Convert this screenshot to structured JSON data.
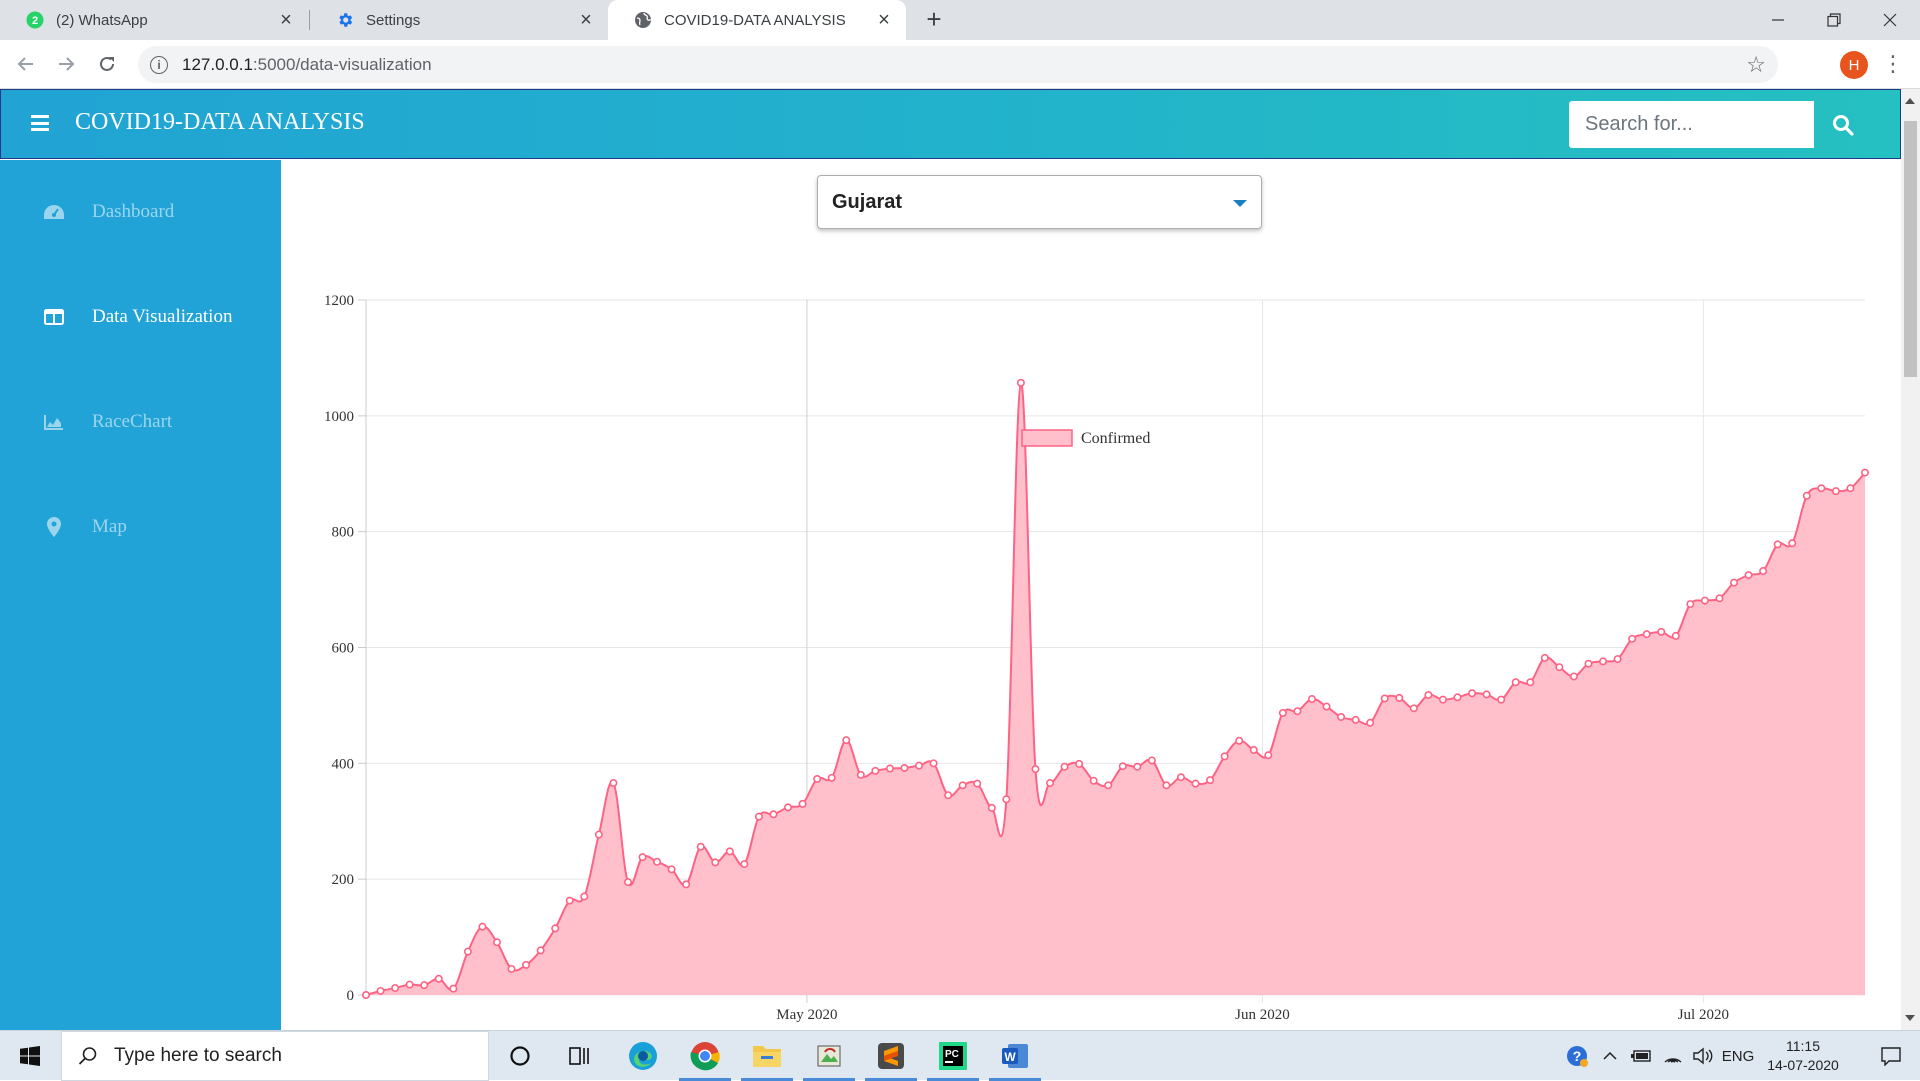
{
  "browser": {
    "tabs": [
      {
        "title": "(2) WhatsApp",
        "badge": "2",
        "icon": "whatsapp-icon",
        "active": false
      },
      {
        "title": "Settings",
        "icon": "gear-icon",
        "active": false
      },
      {
        "title": "COVID19-DATA ANALYSIS",
        "icon": "globe-icon",
        "active": true
      }
    ],
    "url_host": "127.0.0.1",
    "url_path": ":5000/data-visualization",
    "profile_initial": "H"
  },
  "app": {
    "title": "COVID19-DATA ANALYSIS",
    "search_placeholder": "Search for...",
    "accent": "#21a3d8"
  },
  "sidebar": {
    "items": [
      {
        "label": "Dashboard",
        "icon": "tachometer-icon",
        "active": false
      },
      {
        "label": "Data Visualization",
        "icon": "table-icon",
        "active": true
      },
      {
        "label": "RaceChart",
        "icon": "area-chart-icon",
        "active": false
      },
      {
        "label": "Map",
        "icon": "map-marker-icon",
        "active": false
      }
    ]
  },
  "state_select": {
    "value": "Gujarat"
  },
  "chart_data": {
    "type": "area",
    "legend": [
      {
        "label": "Confirmed",
        "position": "top-center"
      }
    ],
    "series": [
      {
        "name": "Confirmed",
        "color": "#ff6384",
        "fill": "#ffc0cb"
      }
    ],
    "x_start": "2020-04-01",
    "x_end": "2020-07-12",
    "x_tick_labels": [
      "May 2020",
      "Jun 2020",
      "Jul 2020"
    ],
    "ylim": [
      0,
      1200
    ],
    "y_ticks": [
      "1200",
      "1000",
      "800",
      "600",
      "400",
      "200",
      "0"
    ],
    "grid": true,
    "values": [
      0,
      7,
      12,
      18,
      17,
      28,
      11,
      75,
      118,
      91,
      45,
      52,
      77,
      115,
      163,
      170,
      277,
      366,
      195,
      238,
      230,
      217,
      191,
      256,
      229,
      248,
      226,
      308,
      312,
      324,
      330,
      373,
      375,
      440,
      380,
      387,
      391,
      392,
      396,
      400,
      345,
      362,
      365,
      323,
      338,
      1057,
      390,
      366,
      394,
      399,
      370,
      362,
      395,
      394,
      405,
      362,
      376,
      365,
      371,
      412,
      439,
      423,
      414,
      487,
      490,
      511,
      498,
      480,
      475,
      470,
      512,
      513,
      495,
      518,
      510,
      514,
      521,
      519,
      510,
      540,
      540,
      582,
      566,
      550,
      572,
      576,
      580,
      615,
      623,
      627,
      620,
      675,
      681,
      685,
      712,
      725,
      732,
      778,
      780,
      862,
      875,
      870,
      875,
      902
    ]
  },
  "taskbar": {
    "search_placeholder": "Type here to search",
    "language": "ENG",
    "time": "11:15",
    "date": "14-07-2020"
  }
}
